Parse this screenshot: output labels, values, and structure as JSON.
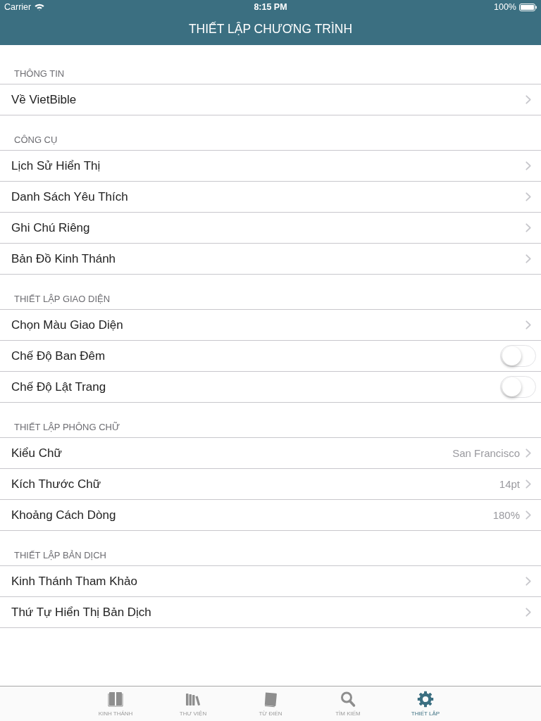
{
  "status_bar": {
    "carrier": "Carrier",
    "time": "8:15 PM",
    "battery": "100%"
  },
  "nav_bar": {
    "title": "THIẾT LẬP CHƯƠNG TRÌNH"
  },
  "sections": [
    {
      "header": "THÔNG TIN",
      "rows": [
        {
          "kind": "link",
          "label": "Về VietBible"
        }
      ]
    },
    {
      "header": "CÔNG CỤ",
      "rows": [
        {
          "kind": "link",
          "label": "Lịch Sử Hiển Thị"
        },
        {
          "kind": "link",
          "label": "Danh Sách Yêu Thích"
        },
        {
          "kind": "link",
          "label": "Ghi Chú Riêng"
        },
        {
          "kind": "link",
          "label": "Bản Đồ Kinh Thánh"
        }
      ]
    },
    {
      "header": "THIẾT LẬP GIAO DIỆN",
      "rows": [
        {
          "kind": "link",
          "label": "Chọn Màu Giao Diện"
        },
        {
          "kind": "toggle",
          "label": "Chế Độ Ban Đêm",
          "on": false
        },
        {
          "kind": "toggle",
          "label": "Chế Độ Lật Trang",
          "on": false
        }
      ]
    },
    {
      "header": "THIẾT LẬP PHÔNG CHỮ",
      "rows": [
        {
          "kind": "link",
          "label": "Kiểu Chữ",
          "value": "San Francisco"
        },
        {
          "kind": "link",
          "label": "Kích Thước Chữ",
          "value": "14pt"
        },
        {
          "kind": "link",
          "label": "Khoảng Cách Dòng",
          "value": "180%"
        }
      ]
    },
    {
      "header": "THIẾT LẬP BẢN DỊCH",
      "rows": [
        {
          "kind": "link",
          "label": "Kinh Thánh Tham Khảo"
        },
        {
          "kind": "link",
          "label": "Thứ Tự Hiển Thị Bản Dịch"
        }
      ]
    }
  ],
  "tab_bar": {
    "tabs": [
      {
        "label": "KINH THÁNH",
        "selected": false
      },
      {
        "label": "THƯ VIỆN",
        "selected": false
      },
      {
        "label": "TỪ ĐIỂN",
        "selected": false
      },
      {
        "label": "TÌM KIẾM",
        "selected": false
      },
      {
        "label": "THIẾT LẬP",
        "selected": true
      }
    ]
  }
}
